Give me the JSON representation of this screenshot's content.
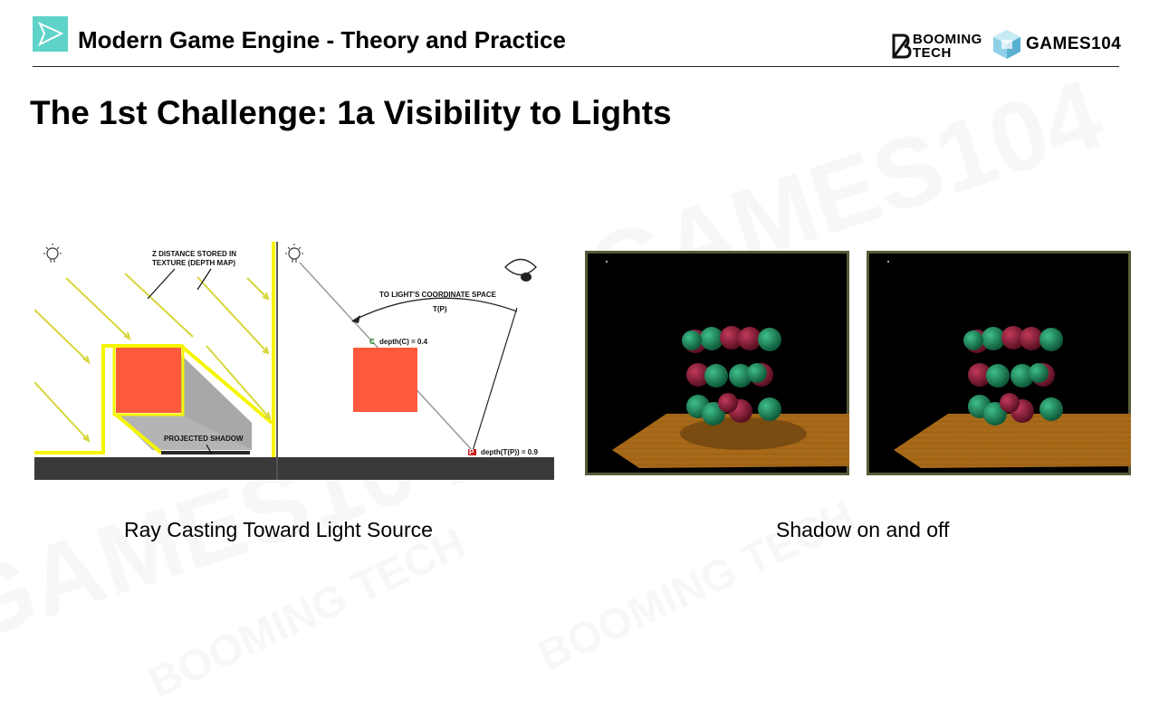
{
  "header": {
    "title": "Modern Game Engine - Theory and Practice",
    "brand_booming_line1": "BOOMING",
    "brand_booming_line2": "TECH",
    "brand_games": "GAMES104"
  },
  "slide": {
    "title": "The 1st Challenge: 1a Visibility to Lights"
  },
  "diagram": {
    "label_depth_map_line1": "Z DISTANCE STORED IN",
    "label_depth_map_line2": "TEXTURE (DEPTH MAP)",
    "label_projected_shadow": "PROJECTED SHADOW",
    "label_light_space": "TO LIGHT'S COORDINATE SPACE",
    "label_transform": "T(P)",
    "label_point_c": "C",
    "label_depth_c": "depth(C) = 0.4",
    "label_point_p": "P",
    "label_depth_p": "depth(T(P)) = 0.9"
  },
  "captions": {
    "left": "Ray Casting Toward Light Source",
    "right": "Shadow on and off"
  },
  "watermarks": [
    "GAMES104",
    "BOOMING TECH"
  ],
  "colors": {
    "accent_teal": "#5fd3c8",
    "ray_yellow": "#f5f500",
    "box_red": "#ff5a3c",
    "shadow_gray": "#b4b4b4",
    "ground_dark": "#3a3a3a",
    "render_frame": "#5a5a3a"
  }
}
